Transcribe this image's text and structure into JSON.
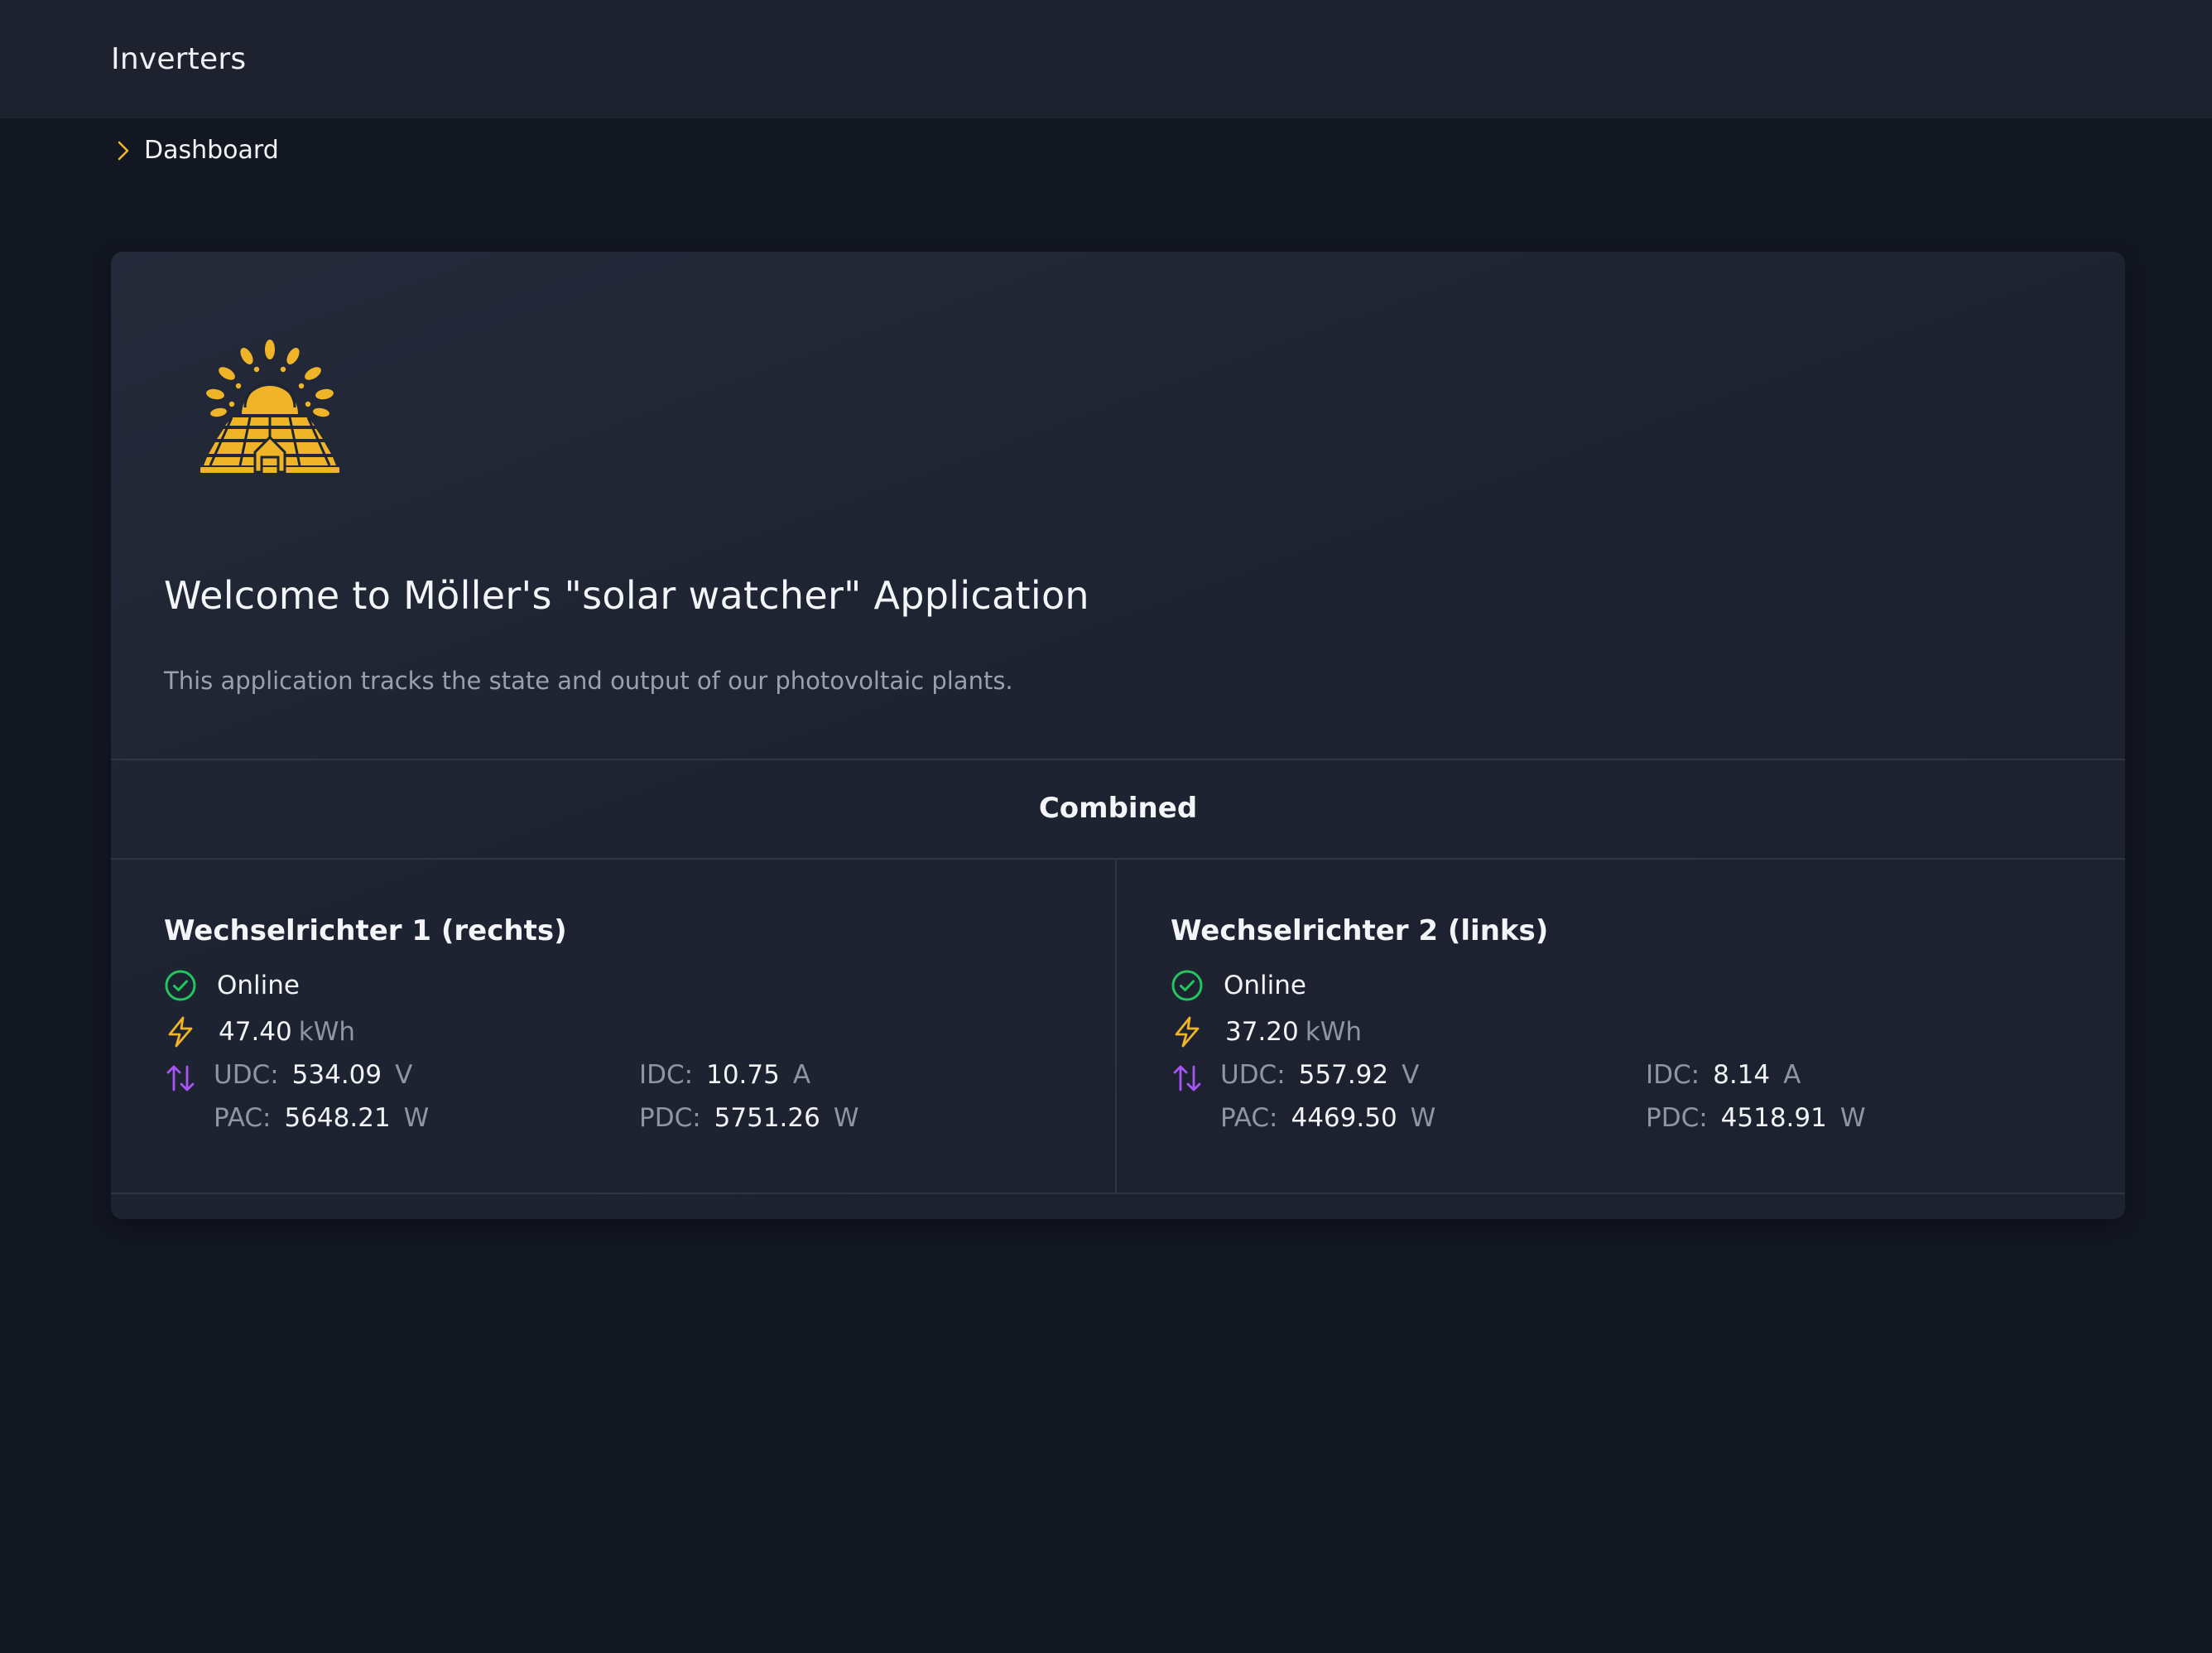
{
  "header": {
    "title": "Inverters"
  },
  "breadcrumb": {
    "items": [
      {
        "label": "Dashboard",
        "icon": "chevron-right-icon"
      }
    ]
  },
  "colors": {
    "background": "#131722",
    "topbar": "#1e222e",
    "card": "#1f2432",
    "accent": "#f0b429",
    "online": "#22c55e",
    "io": "#a855f7",
    "muted": "#8f95a3"
  },
  "welcome": {
    "logo": "solar-panel-sun-logo",
    "title": "Welcome to Möller's \"solar watcher\" Application",
    "description": "This application tracks the state and output of our photovoltaic plants."
  },
  "combined": {
    "label": "Combined"
  },
  "inverters": [
    {
      "name": "Wechselrichter 1 (rechts)",
      "status": "Online",
      "status_icon": "check-circle-icon",
      "energy_icon": "lightning-bolt-icon",
      "energy_value": "47.40",
      "energy_unit": "kWh",
      "io_icon": "arrows-up-down-icon",
      "udc": {
        "label": "UDC:",
        "value": "534.09",
        "unit": "V"
      },
      "idc": {
        "label": "IDC:",
        "value": "10.75",
        "unit": "A"
      },
      "pac": {
        "label": "PAC:",
        "value": "5648.21",
        "unit": "W"
      },
      "pdc": {
        "label": "PDC:",
        "value": "5751.26",
        "unit": "W"
      }
    },
    {
      "name": "Wechselrichter 2 (links)",
      "status": "Online",
      "status_icon": "check-circle-icon",
      "energy_icon": "lightning-bolt-icon",
      "energy_value": "37.20",
      "energy_unit": "kWh",
      "io_icon": "arrows-up-down-icon",
      "udc": {
        "label": "UDC:",
        "value": "557.92",
        "unit": "V"
      },
      "idc": {
        "label": "IDC:",
        "value": "8.14",
        "unit": "A"
      },
      "pac": {
        "label": "PAC:",
        "value": "4469.50",
        "unit": "W"
      },
      "pdc": {
        "label": "PDC:",
        "value": "4518.91",
        "unit": "W"
      }
    }
  ]
}
